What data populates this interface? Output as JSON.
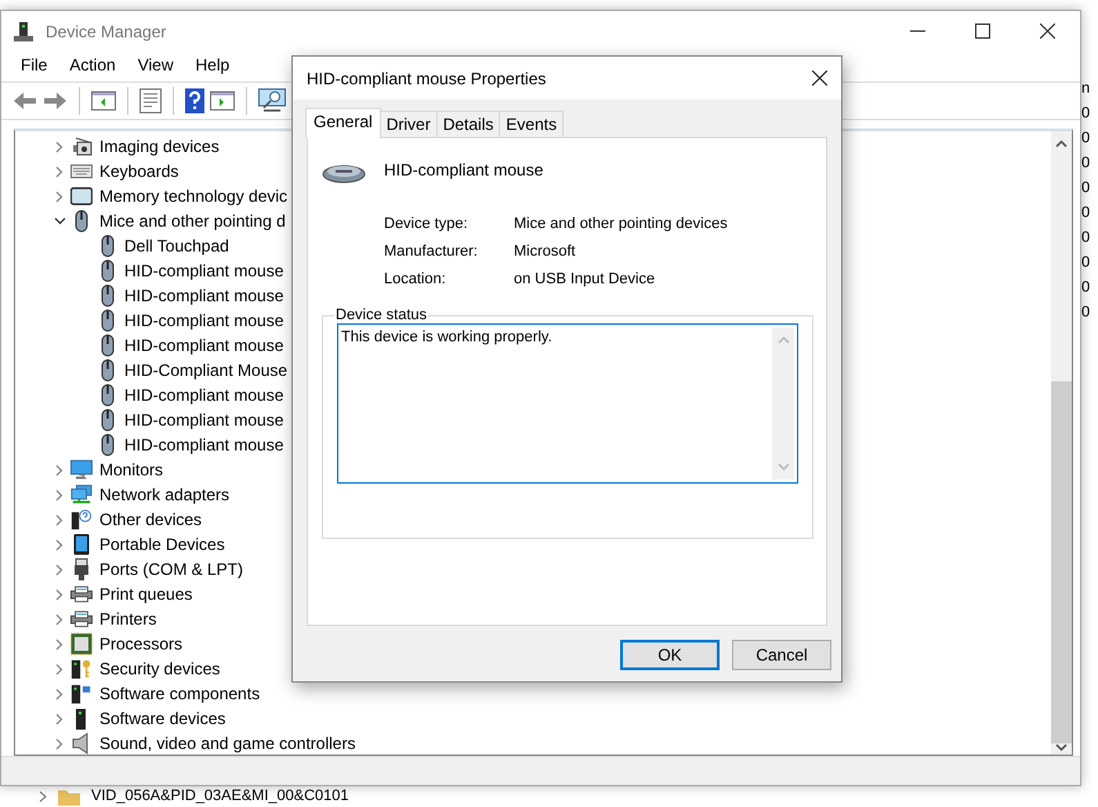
{
  "background_window": {
    "column_text": [
      "n",
      "0",
      "0",
      "0",
      "0",
      "0",
      "0",
      "0",
      "0",
      "0"
    ],
    "bottom_text": "VID_056A&PID_03AE&MI_00&C0101"
  },
  "window": {
    "title": "Device Manager",
    "menu": [
      "File",
      "Action",
      "View",
      "Help"
    ]
  },
  "tree": {
    "items": [
      {
        "label": "Imaging devices",
        "kind": "camera",
        "expanded": false
      },
      {
        "label": "Keyboards",
        "kind": "keyboard",
        "expanded": false
      },
      {
        "label": "Memory technology devic",
        "kind": "memory",
        "expanded": false
      },
      {
        "label": "Mice and other pointing d",
        "kind": "mouse",
        "expanded": true,
        "children": [
          {
            "label": "Dell Touchpad",
            "kind": "mouse"
          },
          {
            "label": "HID-compliant mouse",
            "kind": "mouse"
          },
          {
            "label": "HID-compliant mouse",
            "kind": "mouse"
          },
          {
            "label": "HID-compliant mouse",
            "kind": "mouse"
          },
          {
            "label": "HID-compliant mouse",
            "kind": "mouse"
          },
          {
            "label": "HID-Compliant Mouse",
            "kind": "mouse"
          },
          {
            "label": "HID-compliant mouse",
            "kind": "mouse"
          },
          {
            "label": "HID-compliant mouse",
            "kind": "mouse"
          },
          {
            "label": "HID-compliant mouse",
            "kind": "mouse"
          }
        ]
      },
      {
        "label": "Monitors",
        "kind": "monitor",
        "expanded": false
      },
      {
        "label": "Network adapters",
        "kind": "network",
        "expanded": false
      },
      {
        "label": "Other devices",
        "kind": "other",
        "expanded": false
      },
      {
        "label": "Portable Devices",
        "kind": "portable",
        "expanded": false
      },
      {
        "label": "Ports (COM & LPT)",
        "kind": "port",
        "expanded": false
      },
      {
        "label": "Print queues",
        "kind": "printer",
        "expanded": false
      },
      {
        "label": "Printers",
        "kind": "printer",
        "expanded": false
      },
      {
        "label": "Processors",
        "kind": "processor",
        "expanded": false
      },
      {
        "label": "Security devices",
        "kind": "security",
        "expanded": false
      },
      {
        "label": "Software components",
        "kind": "software_component",
        "expanded": false
      },
      {
        "label": "Software devices",
        "kind": "software",
        "expanded": false
      },
      {
        "label": "Sound, video and game controllers",
        "kind": "sound",
        "expanded": false
      }
    ]
  },
  "dialog": {
    "title": "HID-compliant mouse Properties",
    "tabs": [
      {
        "label": "General",
        "selected": true
      },
      {
        "label": "Driver",
        "selected": false
      },
      {
        "label": "Details",
        "selected": false
      },
      {
        "label": "Events",
        "selected": false
      }
    ],
    "device_name": "HID-compliant mouse",
    "properties": [
      {
        "label": "Device type:",
        "value": "Mice and other pointing devices"
      },
      {
        "label": "Manufacturer:",
        "value": "Microsoft"
      },
      {
        "label": "Location:",
        "value": "on USB Input Device"
      }
    ],
    "status_group": {
      "title": "Device status",
      "text": "This device is working properly."
    },
    "buttons": [
      {
        "label": "OK",
        "default": true
      },
      {
        "label": "Cancel",
        "default": false
      }
    ]
  }
}
